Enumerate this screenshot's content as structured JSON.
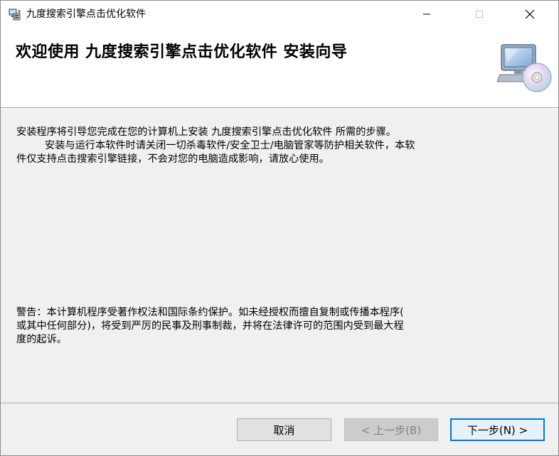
{
  "window": {
    "title": "九度搜索引擎点击优化软件"
  },
  "header": {
    "title": "欢迎使用 九度搜索引擎点击优化软件 安装向导"
  },
  "intro": {
    "lines": [
      "安装程序将引导您完成在您的计算机上安装 九度搜索引擎点击优化软件 所需的步骤。",
      "安装与运行本软件时请关闭一切杀毒软件/安全卫士/电脑管家等防护相关软件，本软",
      "件仅支持点击搜索引擎链接，不会对您的电脑造成影响，请放心使用。"
    ]
  },
  "warning": {
    "lines": [
      "警告：本计算机程序受著作权法和国际条约保护。如未经授权而擅自复制或传播本程序(",
      "或其中任何部分)，将受到严厉的民事及刑事制裁，并将在法律许可的范围内受到最大程",
      "度的起诉。"
    ]
  },
  "buttons": {
    "cancel": "取消",
    "back": "< 上一步(B)",
    "next": "下一步(N) >"
  },
  "colors": {
    "accent": "#0078d7",
    "dialog_bg": "#f0f0f0",
    "header_bg": "#ffffff"
  },
  "icons": {
    "app": "installer-icon",
    "header_art": "computer-cd-icon",
    "minimize": "minimize-icon",
    "maximize": "maximize-icon",
    "close": "close-icon"
  }
}
